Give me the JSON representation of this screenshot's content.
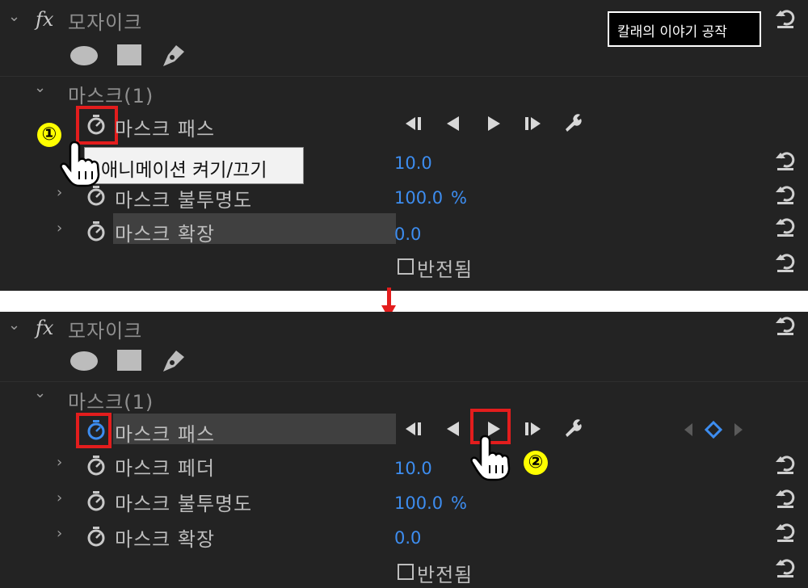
{
  "effect": {
    "fx_symbol": "fx",
    "name": "모자이크"
  },
  "mask": {
    "label": "마스크(1)"
  },
  "watermark": "칼래의 이야기 공작",
  "properties": {
    "path": "마스크 패스",
    "feather": "마스크 페더",
    "opacity": "마스크 불투명도",
    "expansion": "마스크 확장",
    "inverted": "반전됨"
  },
  "values": {
    "feather": "10.0",
    "opacity": "100.0",
    "opacity_unit": "%",
    "expansion": "0.0"
  },
  "tooltip": "애니메이션 켜기/끄기",
  "steps": [
    "①",
    "②"
  ],
  "colors": {
    "panel_bg": "#232323",
    "value_blue": "#3d8df0",
    "highlight_red": "#e31d1d",
    "step_yellow": "#ffff00",
    "arrow_red": "#e31d1d"
  },
  "icons": [
    "chevron-down-icon",
    "ellipse-mask-icon",
    "rectangle-mask-icon",
    "pen-mask-icon",
    "stopwatch-icon",
    "prev-keyframe-icon",
    "track-backward-icon",
    "track-forward-icon",
    "next-keyframe-icon",
    "wrench-icon",
    "reset-icon",
    "keyframe-diamond-icon",
    "pointer-hand-icon",
    "down-arrow-icon"
  ]
}
